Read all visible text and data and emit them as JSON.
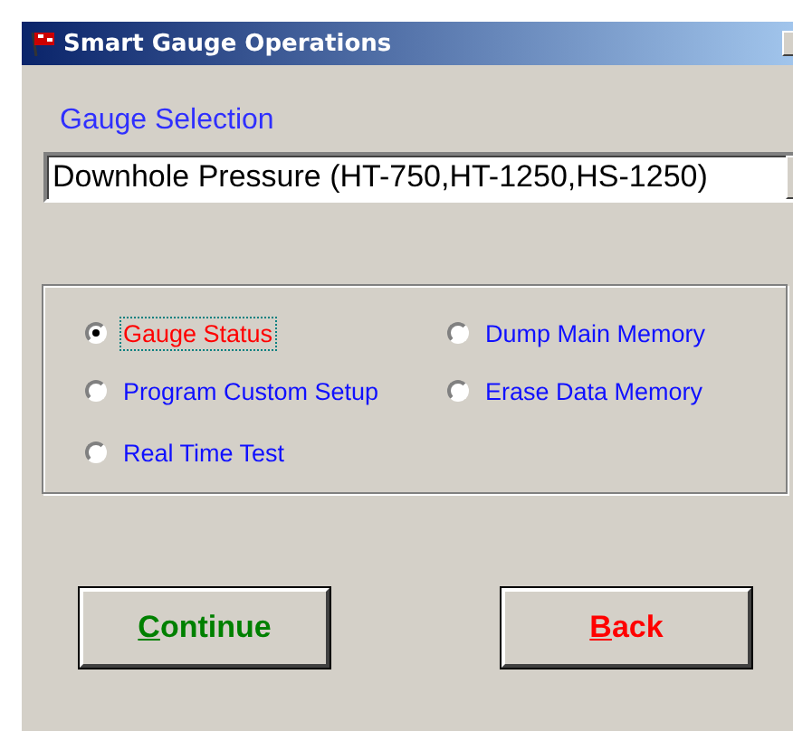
{
  "window": {
    "title": "Smart Gauge Operations"
  },
  "gauge_selection": {
    "label": "Gauge Selection",
    "value": "Downhole Pressure (HT-750,HT-1250,HS-1250)"
  },
  "operations": [
    {
      "label": "Gauge Status",
      "selected": true
    },
    {
      "label": "Dump Main Memory",
      "selected": false
    },
    {
      "label": "Program Custom Setup",
      "selected": false
    },
    {
      "label": "Erase Data Memory",
      "selected": false
    },
    {
      "label": "Real Time Test",
      "selected": false
    }
  ],
  "buttons": [
    {
      "label": "Continue",
      "color": "#008000"
    },
    {
      "label": "Back",
      "color": "#ff0000"
    }
  ]
}
